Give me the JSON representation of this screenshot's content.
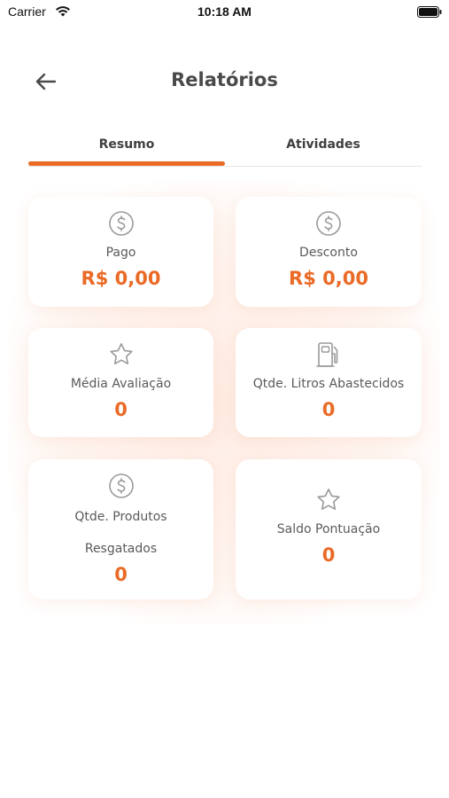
{
  "status_bar": {
    "carrier": "Carrier",
    "time": "10:18 AM"
  },
  "header": {
    "title": "Relatórios",
    "back_icon": "arrow-left-icon"
  },
  "tabs": [
    {
      "label": "Resumo",
      "active": true
    },
    {
      "label": "Atividades",
      "active": false
    }
  ],
  "cards": [
    {
      "icon": "dollar-circle-icon",
      "label": "Pago",
      "value": "R$ 0,00"
    },
    {
      "icon": "dollar-circle-icon",
      "label": "Desconto",
      "value": "R$ 0,00"
    },
    {
      "icon": "star-icon",
      "label": "Média Avaliação",
      "value": "0"
    },
    {
      "icon": "fuel-pump-icon",
      "label": "Qtde. Litros Abastecidos",
      "value": "0"
    },
    {
      "icon": "dollar-circle-icon",
      "label_line1": "Qtde. Produtos",
      "label_line2": "Resgatados",
      "value": "0"
    },
    {
      "icon": "star-icon",
      "label": "Saldo Pontuação",
      "value": "0"
    }
  ],
  "colors": {
    "accent": "#ea6a26",
    "text": "#4a4a4a",
    "icon": "#9a9a9a"
  }
}
